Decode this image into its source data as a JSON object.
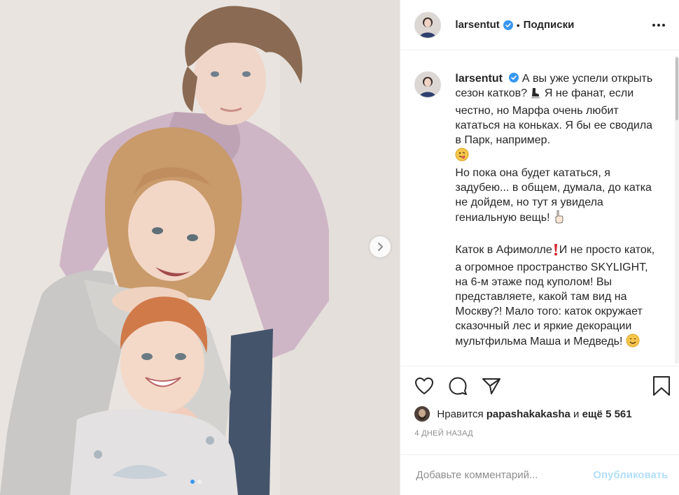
{
  "header": {
    "username": "larsentut",
    "bullet": "•",
    "follow_label": "Подписки"
  },
  "icons": {
    "verified": "verified-badge-icon",
    "more": "more-options-icon",
    "next": "chevron-right-icon",
    "like": "heart-icon",
    "comment": "comment-icon",
    "share": "share-icon",
    "save": "bookmark-icon"
  },
  "caption": {
    "username": "larsentut",
    "seg1": "А вы уже успели открыть сезон катков? ",
    "seg2": " Я не фанат, если честно, но Марфа очень любит кататься на коньках. Я бы ее сводила в Парк, например.\n",
    "seg3": "\nНо пока она будет кататься, я задубею... в общем, думала, до катка не дойдем, но тут я увидела гениальную вещь! ",
    "seg4": "\n\nКаток в Афимолле",
    "seg5": "И не просто каток, а огромное пространство SKYLIGHT, на 6-м этаже под куполом! Вы представляете, какой там вид на Москву?! Мало того: каток окружает сказочный лес и яркие декорации мультфильма Маша и Медведь! "
  },
  "likes": {
    "prefix": "Нравится ",
    "liker": "papashakakasha",
    "and": " и ",
    "others": "ещё 5 561"
  },
  "time_ago": "4 ДНЕЙ НАЗАД",
  "comment_box": {
    "placeholder": "Добавьте комментарий...",
    "publish_label": "Опубликовать"
  },
  "carousel": {
    "count": 2,
    "active_index": 0
  },
  "colors": {
    "verified_blue": "#3897f0",
    "publish_disabled": "#b2dffc",
    "secondary_text": "#8e8e8e"
  }
}
